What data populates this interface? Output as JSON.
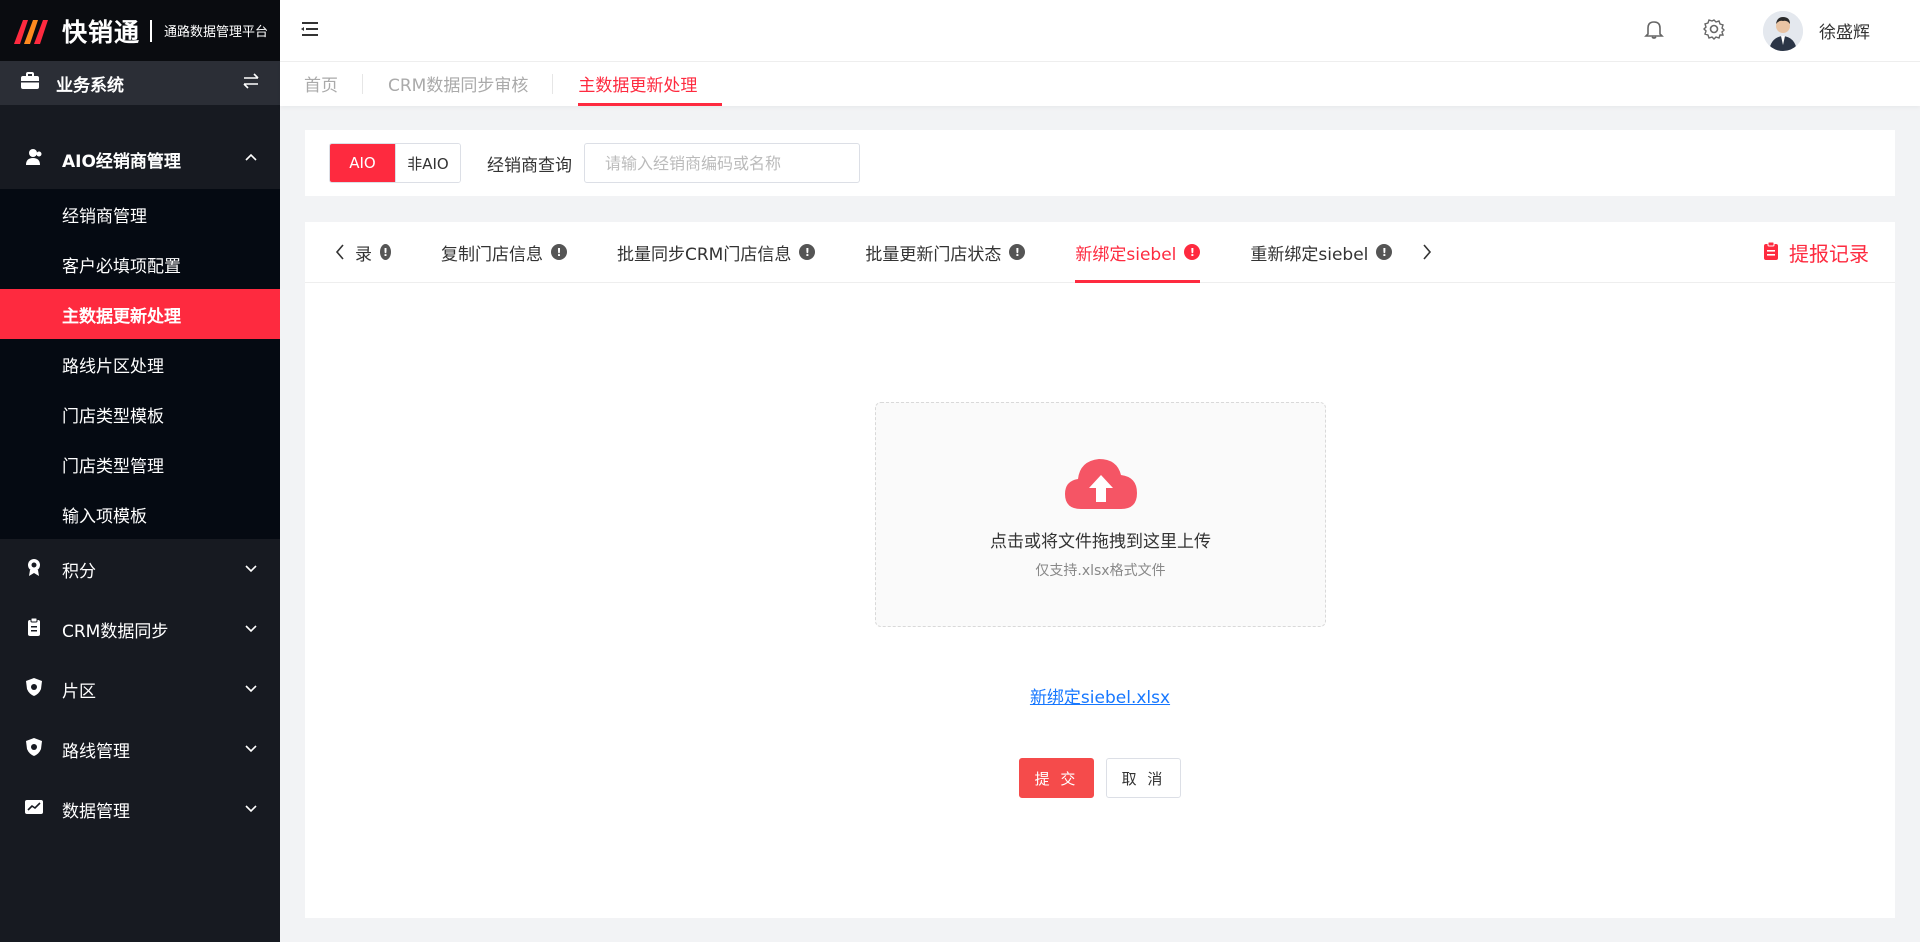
{
  "brand": {
    "name": "快销通",
    "subtitle": "通路数据管理平台"
  },
  "sidebar": {
    "system_switch": "业务系统",
    "open_group": {
      "label": "AIO经销商管理",
      "items": [
        {
          "label": "经销商管理",
          "active": false
        },
        {
          "label": "客户必填项配置",
          "active": false
        },
        {
          "label": "主数据更新处理",
          "active": true
        },
        {
          "label": "路线片区处理",
          "active": false
        },
        {
          "label": "门店类型模板",
          "active": false
        },
        {
          "label": "门店类型管理",
          "active": false
        },
        {
          "label": "输入项模板",
          "active": false
        }
      ]
    },
    "groups": [
      {
        "label": "积分",
        "icon": "medal-icon"
      },
      {
        "label": "CRM数据同步",
        "icon": "clipboard-icon"
      },
      {
        "label": "片区",
        "icon": "shield-icon"
      },
      {
        "label": "路线管理",
        "icon": "shield-icon"
      },
      {
        "label": "数据管理",
        "icon": "chart-icon"
      }
    ]
  },
  "header": {
    "username": "徐盛辉"
  },
  "breadcrumbs": [
    {
      "label": "首页",
      "active": false
    },
    {
      "label": "CRM数据同步审核",
      "active": false
    },
    {
      "label": "主数据更新处理",
      "active": true
    }
  ],
  "filter": {
    "segment_on": "AIO",
    "segment_off": "非AIO",
    "query_label": "经销商查询",
    "query_placeholder": "请输入经销商编码或名称"
  },
  "tabs": {
    "clipped_fragment": "录",
    "items": [
      {
        "label": "复制门店信息",
        "active": false
      },
      {
        "label": "批量同步CRM门店信息",
        "active": false
      },
      {
        "label": "批量更新门店状态",
        "active": false
      },
      {
        "label": "新绑定siebel",
        "active": true
      },
      {
        "label": "重新绑定siebel",
        "active": false
      }
    ],
    "record_link": "提报记录",
    "warn_glyph": "!"
  },
  "upload": {
    "title": "点击或将文件拖拽到这里上传",
    "hint": "仅支持.xlsx格式文件",
    "template_file": "新绑定siebel.xlsx"
  },
  "actions": {
    "submit": "提 交",
    "cancel": "取 消"
  },
  "colors": {
    "accent": "#fe2a3f",
    "sidebar_bg": "#171a21",
    "link": "#1677ff"
  }
}
